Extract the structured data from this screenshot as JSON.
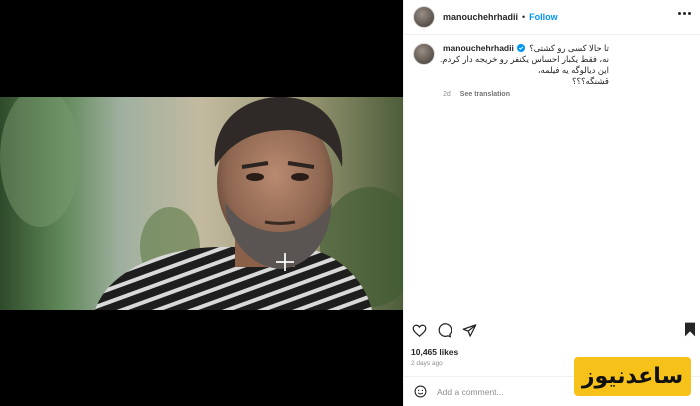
{
  "header": {
    "username": "manouchehrhadii",
    "separator": "•",
    "follow_label": "Follow"
  },
  "caption": {
    "username": "manouchehrhadii",
    "lines": [
      "تا حالا کسی رو کشتی؟",
      "نه، فقط یکبار احساس یکنفر رو خریجه دار کردم.",
      "این دیالوگه یه فیلمه،",
      "قشنگه؟؟؟"
    ],
    "age": "2d",
    "see_translation": "See translation"
  },
  "engagement": {
    "likes": "10,465 likes",
    "time_ago": "2 days ago"
  },
  "comment_box": {
    "placeholder": "Add a comment..."
  },
  "watermark": {
    "text": "ساعدنیوز"
  },
  "colors": {
    "accent": "#0095f6",
    "watermark_bg": "#f6c21a",
    "media_bg": "#000000"
  },
  "icons": {
    "like": "heart-icon",
    "comment": "comment-icon",
    "share": "share-icon",
    "save": "bookmark-icon",
    "verified": "verified-icon",
    "more": "more-icon",
    "emoji": "emoji-icon"
  }
}
